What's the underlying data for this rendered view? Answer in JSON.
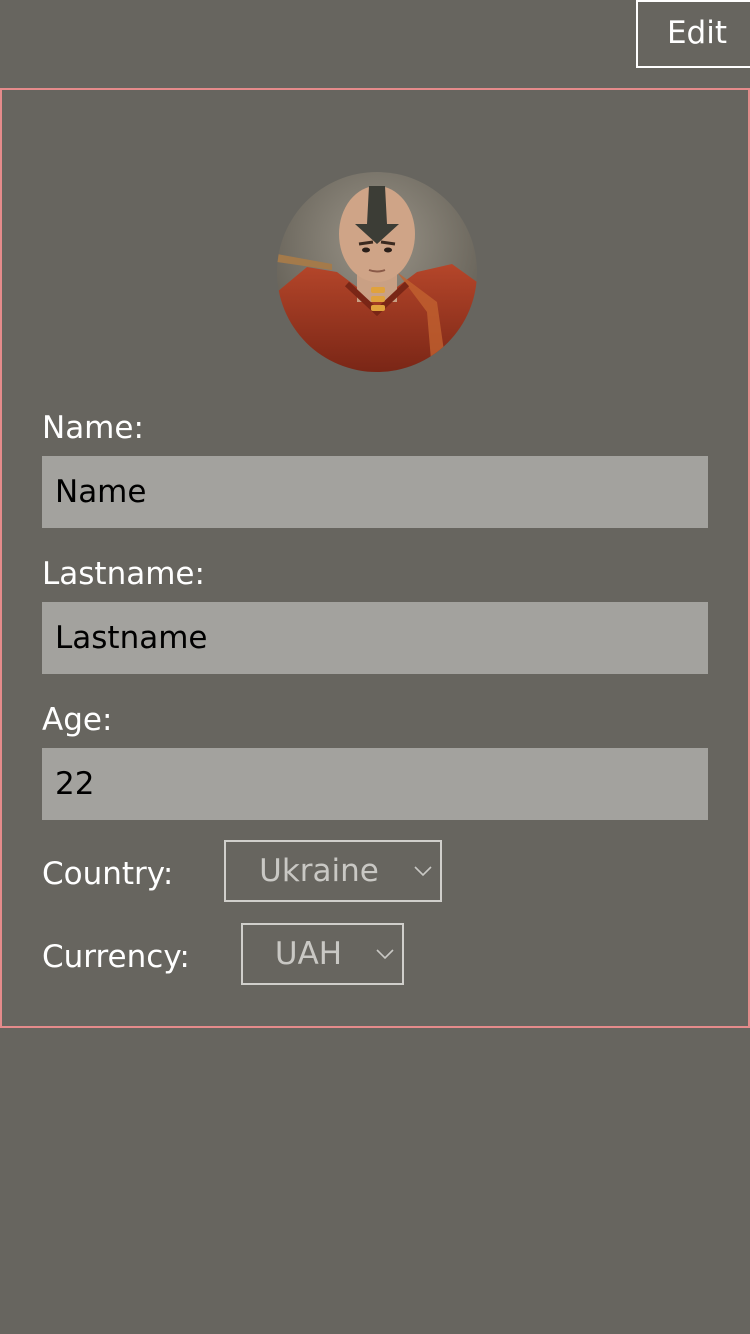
{
  "toolbar": {
    "edit_label": "Edit"
  },
  "profile": {
    "avatar_icon": "user-avatar-photo",
    "name": {
      "label": "Name:",
      "value": "Name"
    },
    "lastname": {
      "label": "Lastname:",
      "value": "Lastname"
    },
    "age": {
      "label": "Age:",
      "value": "22"
    },
    "country": {
      "label": "Country:",
      "selected": "Ukraine"
    },
    "currency": {
      "label": "Currency:",
      "selected": "UAH"
    }
  },
  "colors": {
    "background": "#67655f",
    "card_border": "#e58b8b",
    "input_background": "#a3a29e",
    "select_border": "#d0cfcb"
  }
}
